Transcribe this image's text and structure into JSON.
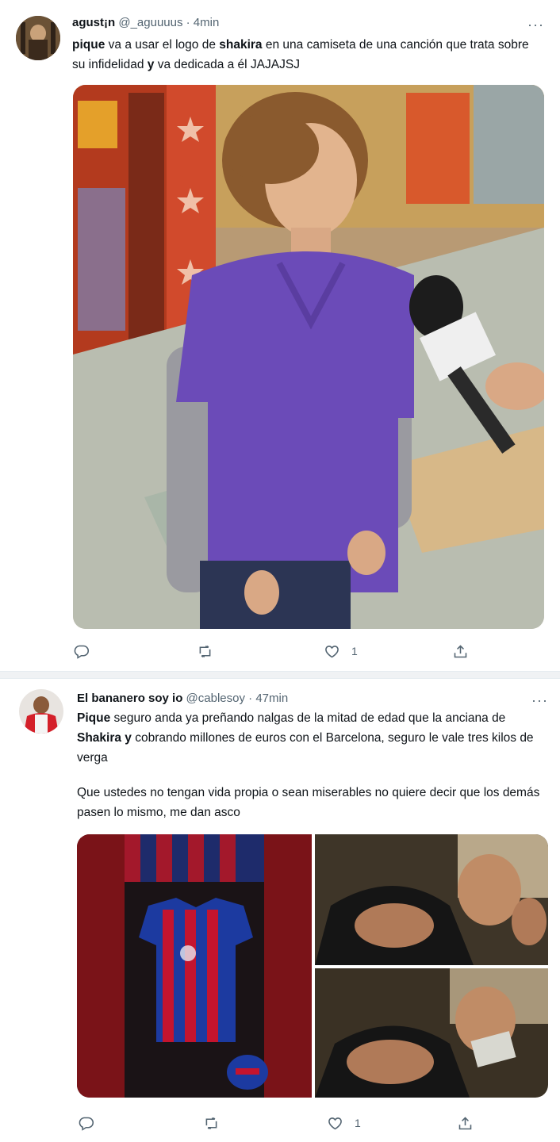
{
  "tweets": [
    {
      "display_name": "agust¡n",
      "handle": "@_aguuuus",
      "time": "· 4min",
      "text_parts": [
        {
          "t": "pique",
          "bold": true
        },
        {
          "t": " va a usar el logo de ",
          "bold": false
        },
        {
          "t": "shakira",
          "bold": true
        },
        {
          "t": " en una camiseta de una canción que trata sobre su infidelidad ",
          "bold": false
        },
        {
          "t": "y",
          "bold": true
        },
        {
          "t": " va dedicada a él JAJAJSJ",
          "bold": false
        }
      ],
      "replies": "",
      "retweets": "",
      "likes": "1",
      "media_count": 1
    },
    {
      "display_name": "El bananero soy io",
      "handle": "@cablesoy",
      "time": "· 47min",
      "text_parts": [
        {
          "t": "Pique",
          "bold": true
        },
        {
          "t": " seguro anda ya preñando nalgas de la mitad de edad que la anciana de ",
          "bold": false
        },
        {
          "t": "Shakira y",
          "bold": true
        },
        {
          "t": " cobrando millones de euros con el Barcelona, seguro le vale tres kilos de verga",
          "bold": false
        }
      ],
      "text2": "Que ustedes no tengan vida propia o sean miserables no quiere decir que los demás pasen lo mismo, me dan asco",
      "replies": "",
      "retweets": "",
      "likes": "1",
      "media_count": 3
    }
  ],
  "icons": {
    "more": "more-horizontal-icon",
    "reply": "reply-bubble-icon",
    "retweet": "retweet-arrows-icon",
    "like": "heart-icon",
    "share": "share-upload-icon"
  },
  "colors": {
    "text": "#0f1419",
    "secondary": "#536471",
    "separator": "#f0f2f4"
  }
}
